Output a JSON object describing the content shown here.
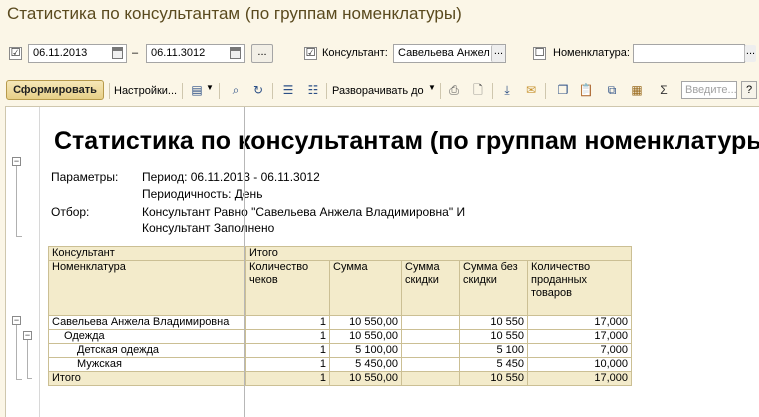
{
  "window": {
    "title": "Статистика по консультантам (по группам номенклатуры)"
  },
  "filters": {
    "period_checked": "☑",
    "date_from": "06.11.2013",
    "date_separator": "–",
    "date_to": "06.11.3012",
    "ellipsis": "...",
    "consultant_checked": "☑",
    "consultant_label": "Консультант:",
    "consultant_value": "Савельева Анжел",
    "nomenclature_checked": "☐",
    "nomenclature_label": "Номенклатура:",
    "nomenclature_value": ""
  },
  "toolbar": {
    "generate_label": "Сформировать",
    "settings_label": "Настройки...",
    "expand_label": "Разворачивать до",
    "search_placeholder": "Введите...",
    "help_label": "?",
    "icons": [
      "variant-icon",
      "find-icon",
      "refresh-icon",
      "group-collapse-icon",
      "group-expand-icon",
      "print-icon",
      "preview-icon",
      "save-icon",
      "mail-icon",
      "copy-icon",
      "paste-icon",
      "copy-cells-icon",
      "paste-cells-icon",
      "sum-icon"
    ]
  },
  "report": {
    "title": "Статистика по консультантам (по группам номенклатуры)",
    "params_label": "Параметры:",
    "period": "Период: 06.11.2013 - 06.11.3012",
    "periodicity": "Периодичность: День",
    "filter_label": "Отбор:",
    "filter_line1": "Консультант Равно \"Савельева Анжела Владимировна\" И",
    "filter_line2": "Консультант Заполнено",
    "header": {
      "consultant": "Консультант",
      "total": "Итого",
      "nomenclature": "Номенклатура",
      "checks_count": "Количество чеков",
      "sum": "Сумма",
      "discount_sum": "Сумма скидки",
      "sum_without_discount": "Сумма без скидки",
      "sold_qty": "Количество проданных товаров"
    },
    "rows": [
      {
        "name": "Савельева Анжела Владимировна",
        "checks": "1",
        "sum": "10 550,00",
        "discount": "",
        "net": "10 550",
        "qty": "17,000"
      },
      {
        "name": "Одежда",
        "checks": "1",
        "sum": "10 550,00",
        "discount": "",
        "net": "10 550",
        "qty": "17,000"
      },
      {
        "name": "Детская одежда",
        "checks": "1",
        "sum": "5 100,00",
        "discount": "",
        "net": "5 100",
        "qty": "7,000"
      },
      {
        "name": "Мужская",
        "checks": "1",
        "sum": "5 450,00",
        "discount": "",
        "net": "5 450",
        "qty": "10,000"
      }
    ],
    "total": {
      "name": "Итого",
      "checks": "1",
      "sum": "10 550,00",
      "discount": "",
      "net": "10 550",
      "qty": "17,000"
    }
  }
}
